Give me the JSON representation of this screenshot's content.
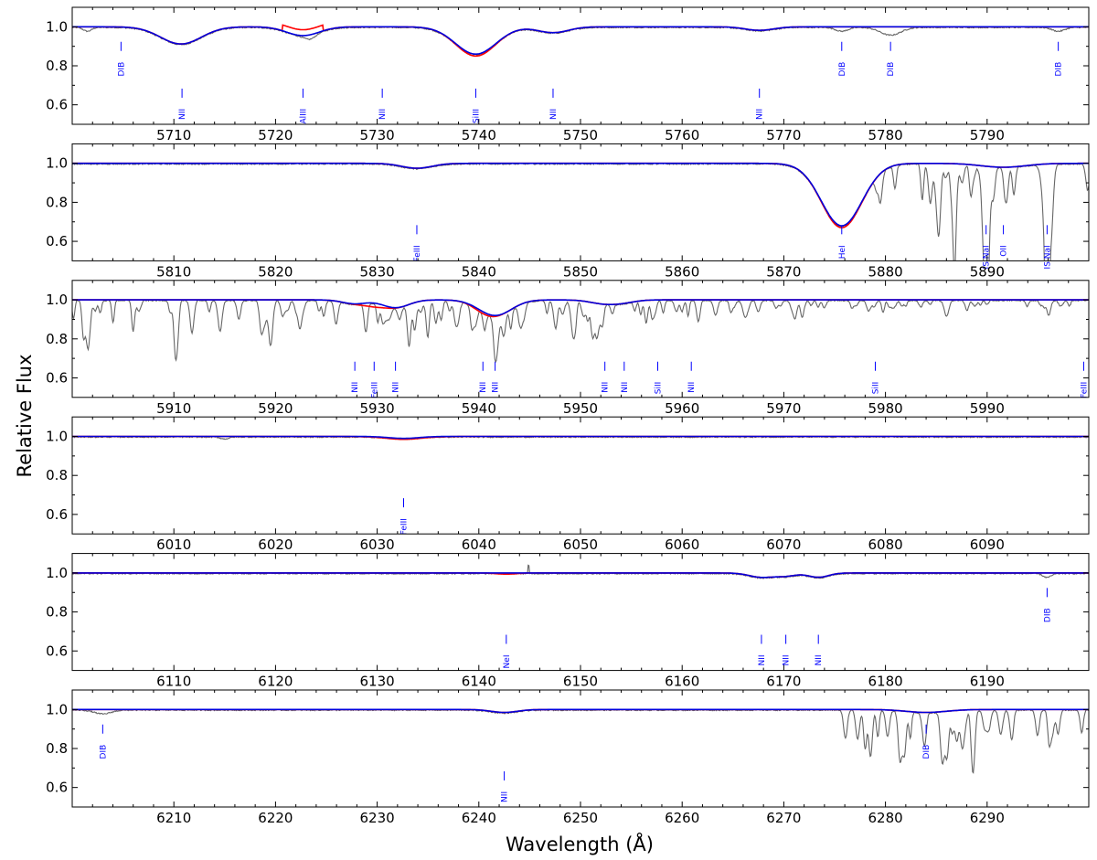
{
  "figure": {
    "xlabel": "Wavelength (Å)",
    "ylabel": "Relative Flux"
  },
  "colors": {
    "observed": "#666666",
    "model_red": "#ff0000",
    "model_blue": "#0000dd",
    "labels": "#0000ff"
  },
  "chart_data": [
    {
      "type": "line",
      "xlim": [
        5700,
        5800
      ],
      "ylim": [
        0.5,
        1.1
      ],
      "xticks": [
        5710,
        5720,
        5730,
        5740,
        5750,
        5760,
        5770,
        5780,
        5790
      ],
      "yticks": [
        0.6,
        0.8,
        1.0
      ],
      "ytick_labels": [
        "0.6",
        "0.8",
        "1.0"
      ],
      "lines": [
        [
          5710.7,
          0.088,
          2.0
        ],
        [
          5722.7,
          0.045,
          1.6
        ],
        [
          5739.7,
          0.14,
          2.0
        ],
        [
          5747.3,
          0.03,
          1.5
        ],
        [
          5767.6,
          0.018,
          1.4
        ]
      ],
      "red_extra": [
        [
          5739.7,
          0.01,
          1.5
        ]
      ],
      "red_minus": [
        [
          5722.7,
          0.03
        ]
      ],
      "telluric": [],
      "dips": [
        [
          5775.7,
          0.02,
          0.6
        ],
        [
          5780.5,
          0.04,
          1.0
        ],
        [
          5797.0,
          0.02,
          0.6
        ],
        [
          5701.5,
          0.02,
          0.4
        ],
        [
          5723.4,
          0.02,
          0.5
        ]
      ],
      "labels": [
        {
          "text": "DIB",
          "x": 5704.8,
          "y": 0.82
        },
        {
          "text": "NII",
          "x": 5710.8,
          "y": 0.58
        },
        {
          "text": "AlIII",
          "x": 5722.7,
          "y": 0.58
        },
        {
          "text": "NII",
          "x": 5730.5,
          "y": 0.58
        },
        {
          "text": "SiIII",
          "x": 5739.7,
          "y": 0.58
        },
        {
          "text": "NII",
          "x": 5747.3,
          "y": 0.58
        },
        {
          "text": "NII",
          "x": 5767.6,
          "y": 0.58
        },
        {
          "text": "DIB",
          "x": 5775.7,
          "y": 0.82
        },
        {
          "text": "DIB",
          "x": 5780.5,
          "y": 0.82
        },
        {
          "text": "DIB",
          "x": 5797.0,
          "y": 0.82
        }
      ]
    },
    {
      "type": "line",
      "xlim": [
        5800,
        5900
      ],
      "ylim": [
        0.5,
        1.1
      ],
      "xticks": [
        5810,
        5820,
        5830,
        5840,
        5850,
        5860,
        5870,
        5880,
        5890
      ],
      "yticks": [
        0.6,
        0.8,
        1.0
      ],
      "ytick_labels": [
        "0.6",
        "0.8",
        "1.0"
      ],
      "lines": [
        [
          5833.9,
          0.025,
          1.5
        ],
        [
          5875.7,
          0.32,
          2.0
        ],
        [
          5891.6,
          0.02,
          2.2
        ]
      ],
      "red_extra": [
        [
          5875.7,
          0.01,
          1.6
        ]
      ],
      "red_minus": [],
      "telluric": [
        [
          5879,
          5900,
          0.05,
          0.2
        ]
      ],
      "dips": [
        [
          5890.0,
          0.62,
          0.15
        ],
        [
          5895.9,
          0.55,
          0.15
        ],
        [
          5889.8,
          0.3,
          0.3
        ],
        [
          5895.7,
          0.25,
          0.3
        ]
      ],
      "labels": [
        {
          "text": "FeIII",
          "x": 5833.9,
          "y": 0.58
        },
        {
          "text": "HeI",
          "x": 5875.7,
          "y": 0.58
        },
        {
          "text": "IS NaI",
          "x": 5889.9,
          "y": 0.58
        },
        {
          "text": "OII",
          "x": 5891.6,
          "y": 0.58
        },
        {
          "text": "IS NaI",
          "x": 5895.9,
          "y": 0.58
        }
      ]
    },
    {
      "type": "line",
      "xlim": [
        5900,
        6000
      ],
      "ylim": [
        0.5,
        1.1
      ],
      "xticks": [
        5910,
        5920,
        5930,
        5940,
        5950,
        5960,
        5970,
        5980,
        5990
      ],
      "yticks": [
        0.6,
        0.8,
        1.0
      ],
      "ytick_labels": [
        "0.6",
        "0.8",
        "1.0"
      ],
      "lines": [
        [
          5927.8,
          0.02,
          1.2
        ],
        [
          5931.8,
          0.04,
          1.3
        ],
        [
          5941.6,
          0.08,
          1.6
        ],
        [
          5952.4,
          0.02,
          1.4
        ],
        [
          5954.3,
          0.01,
          1.2
        ]
      ],
      "red_extra": [
        [
          5929.7,
          0.02,
          1.0
        ],
        [
          5940.4,
          0.01,
          1.0
        ]
      ],
      "red_minus": [],
      "telluric": [
        [
          5900,
          5965,
          0.04,
          0.12
        ],
        [
          5965,
          6000,
          0.02,
          0.04
        ]
      ],
      "dips": [
        [
          5901.5,
          0.15,
          0.2
        ],
        [
          5918.9,
          0.12,
          0.25
        ],
        [
          5941.7,
          0.1,
          0.25
        ],
        [
          5919.6,
          0.1,
          0.2
        ]
      ],
      "labels": [
        {
          "text": "NII",
          "x": 5927.8,
          "y": 0.58
        },
        {
          "text": "FeIII",
          "x": 5929.7,
          "y": 0.58
        },
        {
          "text": "NII",
          "x": 5931.8,
          "y": 0.58
        },
        {
          "text": "NII",
          "x": 5940.4,
          "y": 0.58
        },
        {
          "text": "NII",
          "x": 5941.6,
          "y": 0.58
        },
        {
          "text": "NII",
          "x": 5952.4,
          "y": 0.58
        },
        {
          "text": "NII",
          "x": 5954.3,
          "y": 0.58
        },
        {
          "text": "SiII",
          "x": 5957.6,
          "y": 0.58
        },
        {
          "text": "NII",
          "x": 5960.9,
          "y": 0.58
        },
        {
          "text": "SiII",
          "x": 5979.0,
          "y": 0.58
        },
        {
          "text": "FeIII",
          "x": 5999.5,
          "y": 0.58
        }
      ]
    },
    {
      "type": "line",
      "xlim": [
        6000,
        6100
      ],
      "ylim": [
        0.5,
        1.1
      ],
      "xticks": [
        6010,
        6020,
        6030,
        6040,
        6050,
        6060,
        6070,
        6080,
        6090
      ],
      "yticks": [
        0.6,
        0.8,
        1.0
      ],
      "ytick_labels": [
        "0.6",
        "0.8",
        "1.0"
      ],
      "lines": [
        [
          6032.6,
          0.01,
          1.5
        ]
      ],
      "red_extra": [
        [
          6032.6,
          0.005,
          2.5
        ]
      ],
      "red_minus": [],
      "telluric": [],
      "dips": [
        [
          6015.0,
          0.01,
          0.4
        ]
      ],
      "labels": [
        {
          "text": "FeIII",
          "x": 6032.6,
          "y": 0.58
        }
      ]
    },
    {
      "type": "line",
      "xlim": [
        6100,
        6200
      ],
      "ylim": [
        0.5,
        1.1
      ],
      "xticks": [
        6110,
        6120,
        6130,
        6140,
        6150,
        6160,
        6170,
        6180,
        6190
      ],
      "yticks": [
        0.6,
        0.8,
        1.0
      ],
      "ytick_labels": [
        "0.6",
        "0.8",
        "1.0"
      ],
      "lines": [
        [
          6167.8,
          0.022,
          1.2
        ],
        [
          6170.2,
          0.015,
          1.0
        ],
        [
          6173.4,
          0.022,
          1.0
        ]
      ],
      "red_extra": [
        [
          6142.7,
          0.006,
          1.0
        ]
      ],
      "red_minus": [],
      "telluric": [],
      "dips": [
        [
          6195.9,
          0.02,
          0.4
        ]
      ],
      "spikes": [
        [
          6144.9,
          0.04
        ]
      ],
      "labels": [
        {
          "text": "NeI",
          "x": 6142.7,
          "y": 0.58
        },
        {
          "text": "NII",
          "x": 6167.8,
          "y": 0.58
        },
        {
          "text": "NII",
          "x": 6170.2,
          "y": 0.58
        },
        {
          "text": "NII",
          "x": 6173.4,
          "y": 0.58
        },
        {
          "text": "DIB",
          "x": 6195.9,
          "y": 0.82
        }
      ]
    },
    {
      "type": "line",
      "xlim": [
        6200,
        6300
      ],
      "ylim": [
        0.5,
        1.1
      ],
      "xticks": [
        6210,
        6220,
        6230,
        6240,
        6250,
        6260,
        6270,
        6280,
        6290
      ],
      "yticks": [
        0.6,
        0.8,
        1.0
      ],
      "ytick_labels": [
        "0.6",
        "0.8",
        "1.0"
      ],
      "lines": [
        [
          6242.5,
          0.015,
          1.3
        ],
        [
          6284.0,
          0.015,
          2.0
        ]
      ],
      "red_extra": [],
      "red_minus": [],
      "telluric": [
        [
          6276,
          6300,
          0.08,
          0.16
        ]
      ],
      "dips": [
        [
          6203.0,
          0.02,
          0.8
        ],
        [
          6278.0,
          0.2,
          0.15
        ]
      ],
      "labels": [
        {
          "text": "DIB",
          "x": 6203.0,
          "y": 0.82
        },
        {
          "text": "NII",
          "x": 6242.5,
          "y": 0.58
        },
        {
          "text": "DIB",
          "x": 6284.0,
          "y": 0.82
        }
      ]
    }
  ]
}
